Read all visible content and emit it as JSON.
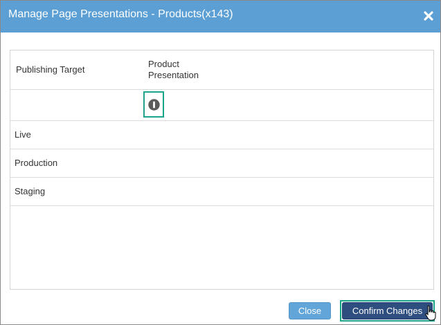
{
  "dialog": {
    "title": "Manage Page Presentations - Products(x143)",
    "close_icon": "close-icon"
  },
  "table": {
    "headers": {
      "publishing_target": "Publishing Target",
      "product_presentation": "Product Presentation"
    },
    "info_icon": "info-icon",
    "rows": [
      {
        "label": "Live"
      },
      {
        "label": "Production"
      },
      {
        "label": "Staging"
      }
    ]
  },
  "footer": {
    "close_label": "Close",
    "confirm_label": "Confirm Changes"
  },
  "colors": {
    "titlebar": "#5b9fd5",
    "highlight": "#1aa58b",
    "close_button": "#62a5d9",
    "confirm_button": "#2e4e80"
  }
}
